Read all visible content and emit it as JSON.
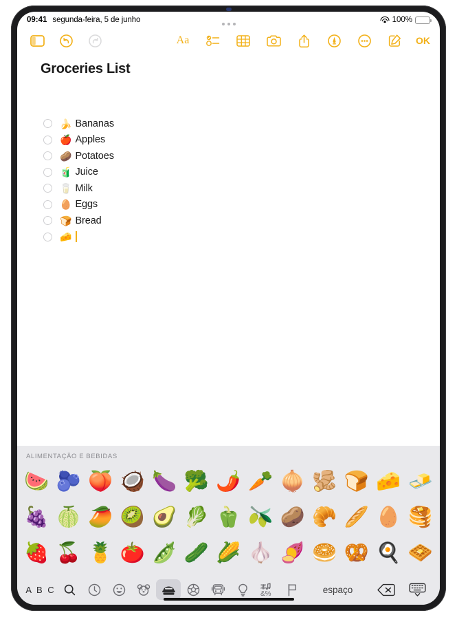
{
  "status_bar": {
    "time": "09:41",
    "date": "segunda-feira, 5 de junho",
    "battery_percent": "100%",
    "wifi_icon": "wifi-icon",
    "battery_icon": "battery-icon"
  },
  "toolbar": {
    "sidebar_icon": "sidebar-toggle-icon",
    "undo_icon": "undo-icon",
    "redo_icon": "redo-icon",
    "format_label": "Aa",
    "checklist_icon": "checklist-icon",
    "table_icon": "table-icon",
    "camera_icon": "camera-icon",
    "share_icon": "share-icon",
    "markup_icon": "markup-pen-icon",
    "more_icon": "more-ellipsis-icon",
    "compose_icon": "compose-icon",
    "done_label": "OK"
  },
  "note": {
    "title": "Groceries List",
    "checklist": [
      {
        "emoji": "🍌",
        "text": "Bananas",
        "checked": false
      },
      {
        "emoji": "🍎",
        "text": "Apples",
        "checked": false
      },
      {
        "emoji": "🥔",
        "text": "Potatoes",
        "checked": false
      },
      {
        "emoji": "🧃",
        "text": "Juice",
        "checked": false
      },
      {
        "emoji": "🥛",
        "text": "Milk",
        "checked": false
      },
      {
        "emoji": "🥚",
        "text": "Eggs",
        "checked": false
      },
      {
        "emoji": "🍞",
        "text": "Bread",
        "checked": false
      },
      {
        "emoji": "🧀",
        "text": "",
        "checked": false
      }
    ]
  },
  "keyboard": {
    "category_title": "ALIMENTAÇÃO E BEBIDAS",
    "emoji_rows": [
      [
        "🍉",
        "🫐",
        "🍑",
        "🥥",
        "🍆",
        "🥦",
        "🌶️",
        "🥕",
        "🧅",
        "🫚",
        "🍞",
        "🧀",
        "🧈"
      ],
      [
        "🍇",
        "🍈",
        "🥭",
        "🥝",
        "🥑",
        "🥬",
        "🫑",
        "🫒",
        "🥔",
        "🥐",
        "🥖",
        "🥚",
        "🥞"
      ],
      [
        "🍓",
        "🍒",
        "🍍",
        "🍅",
        "🫛",
        "🥒",
        "🌽",
        "🧄",
        "🍠",
        "🥯",
        "🥨",
        "🍳",
        "🧇"
      ]
    ],
    "bottom_bar": {
      "abc_label": "A B C",
      "search_icon": "search-icon",
      "recents_icon": "clock-recents-icon",
      "smileys_icon": "smiley-face-icon",
      "animals_icon": "bear-animals-icon",
      "food_icon": "food-drink-icon",
      "activity_icon": "soccer-ball-activity-icon",
      "travel_icon": "car-travel-icon",
      "objects_icon": "lightbulb-objects-icon",
      "symbols_icon": "symbols-icon",
      "flags_icon": "flag-icon",
      "space_label": "espaço",
      "delete_icon": "delete-backspace-icon",
      "dismiss_icon": "dismiss-keyboard-icon",
      "active_category": "food"
    }
  },
  "colors": {
    "accent": "#f2b017",
    "keyboard_bg": "#e9e9ec",
    "key_active": "#d3d3d9"
  }
}
